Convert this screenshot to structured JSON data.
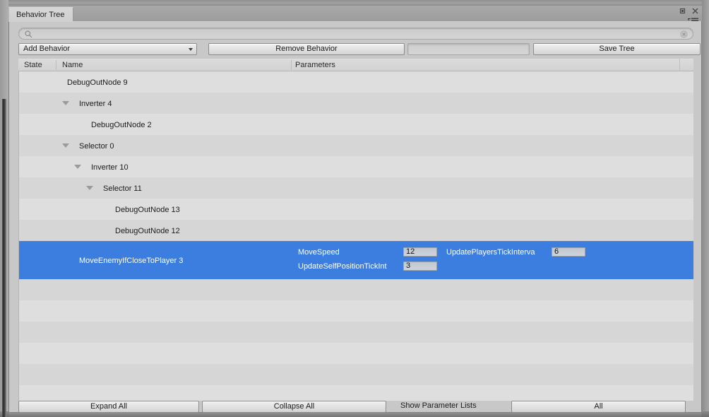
{
  "window": {
    "tab_title": "Behavior Tree",
    "controls": {
      "maximize": "maximize-icon",
      "close": "close-icon",
      "menu": "panel-menu-icon"
    }
  },
  "search": {
    "value": "",
    "placeholder": "",
    "icon": "search-icon",
    "clear_icon": "clear-search-icon"
  },
  "toolbar": {
    "add_behavior_label": "Add Behavior",
    "remove_behavior_label": "Remove Behavior",
    "name_field_value": "",
    "name_field_placeholder": "",
    "save_tree_label": "Save Tree"
  },
  "columns": {
    "state": "State",
    "name": "Name",
    "parameters": "Parameters"
  },
  "tree": {
    "rows": [
      {
        "name": "DebugOutNode 9",
        "indent": 0,
        "expander": false,
        "selected": false
      },
      {
        "name": "Inverter 4",
        "indent": 1,
        "expander": true,
        "selected": false
      },
      {
        "name": "DebugOutNode 2",
        "indent": 2,
        "expander": false,
        "selected": false
      },
      {
        "name": "Selector 0",
        "indent": 1,
        "expander": true,
        "selected": false
      },
      {
        "name": "Inverter 10",
        "indent": 2,
        "expander": true,
        "selected": false
      },
      {
        "name": "Selector 11",
        "indent": 3,
        "expander": true,
        "selected": false
      },
      {
        "name": "DebugOutNode 13",
        "indent": 4,
        "expander": false,
        "selected": false
      },
      {
        "name": "DebugOutNode 12",
        "indent": 4,
        "expander": false,
        "selected": false
      },
      {
        "name": "MoveEnemyIfCloseToPlayer 3",
        "indent": 1,
        "expander": false,
        "selected": true
      }
    ],
    "selected_row_parameters": [
      {
        "label": "MoveSpeed",
        "value": "12",
        "col": 0,
        "line": 0
      },
      {
        "label": "UpdatePlayersTickInterva",
        "value": "6",
        "col": 1,
        "line": 0
      },
      {
        "label": "UpdateSelfPositionTickInt",
        "value": "3",
        "col": 0,
        "line": 1
      }
    ]
  },
  "footer": {
    "expand_all": "Expand All",
    "collapse_all": "Collapse All",
    "show_parameter_lists": "Show Parameter Lists",
    "all": "All"
  },
  "colors": {
    "selection": "#3c7ee0",
    "panel": "#c8c8c8",
    "row_odd": "#dedede",
    "row_even": "#d6d6d6"
  }
}
